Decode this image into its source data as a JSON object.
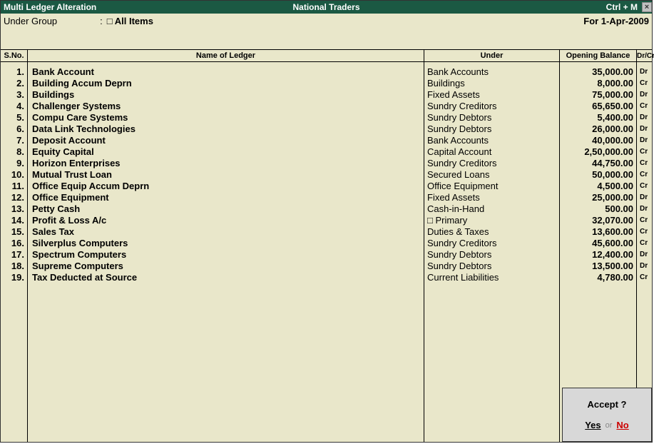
{
  "header": {
    "title_left": "Multi Ledger  Alteration",
    "title_center": "National Traders",
    "shortcut": "Ctrl + M",
    "close": "×"
  },
  "subheader": {
    "label": "Under Group",
    "value": "All Items",
    "date": "For 1-Apr-2009"
  },
  "columns": {
    "sno": "S.No.",
    "name": "Name of Ledger",
    "under": "Under",
    "balance": "Opening Balance",
    "drcr": "Dr/Cr"
  },
  "ledgers": [
    {
      "sno": "1.",
      "name": "Bank Account",
      "under": "Bank Accounts",
      "balance": "35,000.00",
      "drcr": "Dr",
      "primary": false
    },
    {
      "sno": "2.",
      "name": "Building Accum Deprn",
      "under": "Buildings",
      "balance": "8,000.00",
      "drcr": "Cr",
      "primary": false
    },
    {
      "sno": "3.",
      "name": "Buildings",
      "under": "Fixed Assets",
      "balance": "75,000.00",
      "drcr": "Dr",
      "primary": false
    },
    {
      "sno": "4.",
      "name": "Challenger Systems",
      "under": "Sundry Creditors",
      "balance": "65,650.00",
      "drcr": "Cr",
      "primary": false
    },
    {
      "sno": "5.",
      "name": "Compu Care Systems",
      "under": "Sundry Debtors",
      "balance": "5,400.00",
      "drcr": "Dr",
      "primary": false
    },
    {
      "sno": "6.",
      "name": "Data Link Technologies",
      "under": "Sundry Debtors",
      "balance": "26,000.00",
      "drcr": "Dr",
      "primary": false
    },
    {
      "sno": "7.",
      "name": "Deposit Account",
      "under": "Bank Accounts",
      "balance": "40,000.00",
      "drcr": "Dr",
      "primary": false
    },
    {
      "sno": "8.",
      "name": "Equity Capital",
      "under": "Capital Account",
      "balance": "2,50,000.00",
      "drcr": "Cr",
      "primary": false
    },
    {
      "sno": "9.",
      "name": "Horizon Enterprises",
      "under": "Sundry Creditors",
      "balance": "44,750.00",
      "drcr": "Cr",
      "primary": false
    },
    {
      "sno": "10.",
      "name": "Mutual Trust Loan",
      "under": "Secured Loans",
      "balance": "50,000.00",
      "drcr": "Cr",
      "primary": false
    },
    {
      "sno": "11.",
      "name": "Office Equip Accum Deprn",
      "under": "Office Equipment",
      "balance": "4,500.00",
      "drcr": "Cr",
      "primary": false
    },
    {
      "sno": "12.",
      "name": "Office Equipment",
      "under": "Fixed Assets",
      "balance": "25,000.00",
      "drcr": "Dr",
      "primary": false
    },
    {
      "sno": "13.",
      "name": "Petty Cash",
      "under": "Cash-in-Hand",
      "balance": "500.00",
      "drcr": "Dr",
      "primary": false
    },
    {
      "sno": "14.",
      "name": "Profit & Loss A/c",
      "under": "Primary",
      "balance": "32,070.00",
      "drcr": "Cr",
      "primary": true
    },
    {
      "sno": "15.",
      "name": "Sales Tax",
      "under": "Duties & Taxes",
      "balance": "13,600.00",
      "drcr": "Cr",
      "primary": false
    },
    {
      "sno": "16.",
      "name": "Silverplus Computers",
      "under": "Sundry Creditors",
      "balance": "45,600.00",
      "drcr": "Cr",
      "primary": false
    },
    {
      "sno": "17.",
      "name": "Spectrum Computers",
      "under": "Sundry Debtors",
      "balance": "12,400.00",
      "drcr": "Dr",
      "primary": false
    },
    {
      "sno": "18.",
      "name": "Supreme Computers",
      "under": "Sundry Debtors",
      "balance": "13,500.00",
      "drcr": "Dr",
      "primary": false
    },
    {
      "sno": "19.",
      "name": "Tax Deducted at Source",
      "under": "Current Liabilities",
      "balance": "4,780.00",
      "drcr": "Cr",
      "primary": false
    }
  ],
  "accept": {
    "title": "Accept ?",
    "yes": "Yes",
    "or": "or",
    "no": "No"
  }
}
